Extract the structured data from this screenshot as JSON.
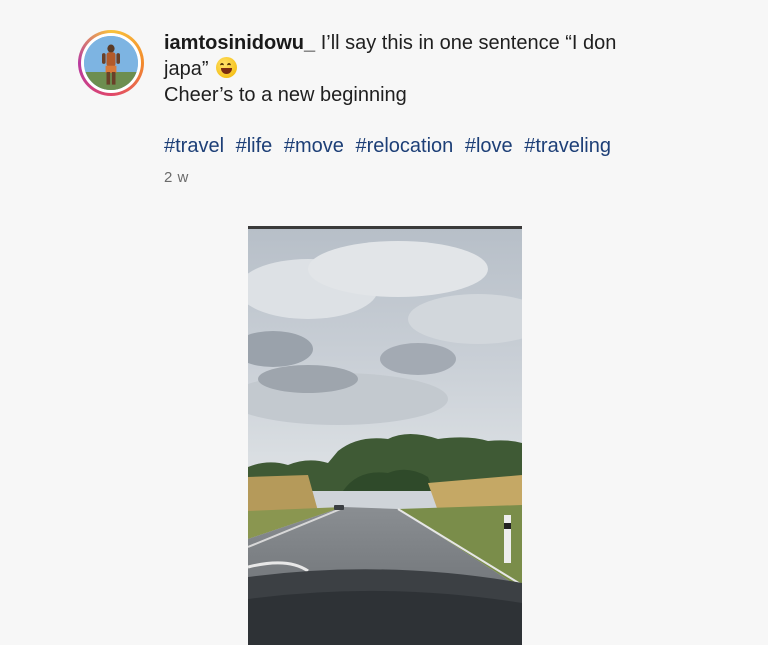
{
  "post": {
    "username": "iamtosinidowu_",
    "caption_line1_rest": "I’ll say this in one sentence “I don",
    "caption_line2": "japa”",
    "caption_line3": "Cheer’s to a new beginning",
    "emoji_name": "grinning-sweat-emoji",
    "hashtags": [
      "#travel",
      "#life",
      "#move",
      "#relocation",
      "#love",
      "#traveling"
    ],
    "timestamp": "2 w"
  },
  "colors": {
    "hashtag": "#1d3f77",
    "background": "#f7f7f7",
    "timestamp": "#6b6b6b"
  }
}
